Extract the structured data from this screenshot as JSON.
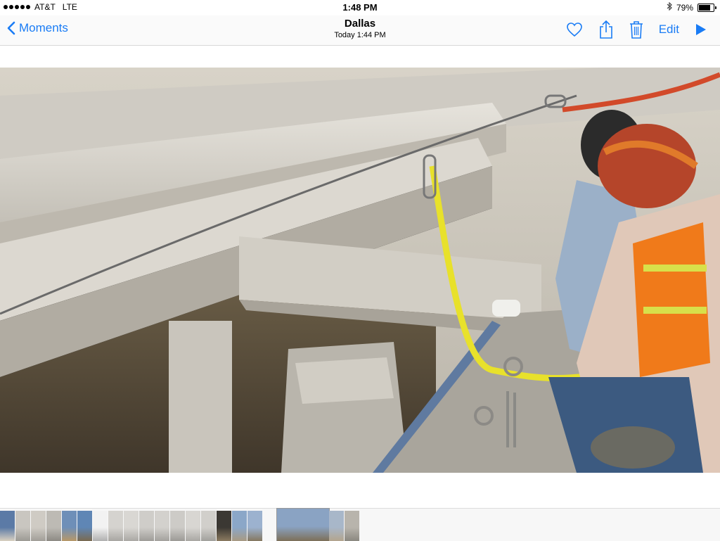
{
  "status_bar": {
    "carrier": "AT&T",
    "network": "LTE",
    "time": "1:48 PM",
    "battery_percent": "79%",
    "battery_level": 0.79,
    "signal_icon": "signal-dots-icon",
    "bluetooth_icon": "bluetooth-icon"
  },
  "nav": {
    "back_label": "Moments",
    "title": "Dallas",
    "subtitle": "Today  1:44 PM",
    "edit_label": "Edit",
    "accent": "#1a7cf5"
  },
  "icons": {
    "back": "chevron-left-icon",
    "favorite": "heart-icon",
    "share": "share-icon",
    "delete": "trash-icon",
    "play": "play-icon"
  },
  "photo": {
    "description_icon": "photo-image",
    "selected_thumbnail_index": 17
  },
  "thumbnails": [
    {
      "color": "#5b7aa6",
      "accent": "#d9d0c0"
    },
    {
      "color": "#c9c6c0",
      "accent": "#9c9a94"
    },
    {
      "color": "#cfcbc4",
      "accent": "#a19e98"
    },
    {
      "color": "#bdbab4",
      "accent": "#8d8a84"
    },
    {
      "color": "#6e8fb8",
      "accent": "#b89868"
    },
    {
      "color": "#5f86b5",
      "accent": "#7a6a50"
    },
    {
      "color": "#f2f2f2",
      "accent": "#b0b0b0"
    },
    {
      "color": "#d5d3cf",
      "accent": "#a8a6a2"
    },
    {
      "color": "#d9d7d3",
      "accent": "#aaa8a4"
    },
    {
      "color": "#cfcdc9",
      "accent": "#9e9c98"
    },
    {
      "color": "#d3d1cd",
      "accent": "#a3a19d"
    },
    {
      "color": "#cdcbc7",
      "accent": "#9c9a96"
    },
    {
      "color": "#d8d6d2",
      "accent": "#a9a7a3"
    },
    {
      "color": "#d1cfcb",
      "accent": "#a1a09c"
    },
    {
      "color": "#3b3833",
      "accent": "#8a7a60"
    },
    {
      "color": "#8ba7c8",
      "accent": "#a89a82"
    },
    {
      "color": "#9cb2cf",
      "accent": "#857760"
    },
    {
      "color": "#8aa3c3",
      "accent": "#7d6f58"
    },
    {
      "color": "#a8b7c9",
      "accent": "#b3a58d"
    },
    {
      "color": "#b8b4ac",
      "accent": "#8b8880"
    }
  ]
}
